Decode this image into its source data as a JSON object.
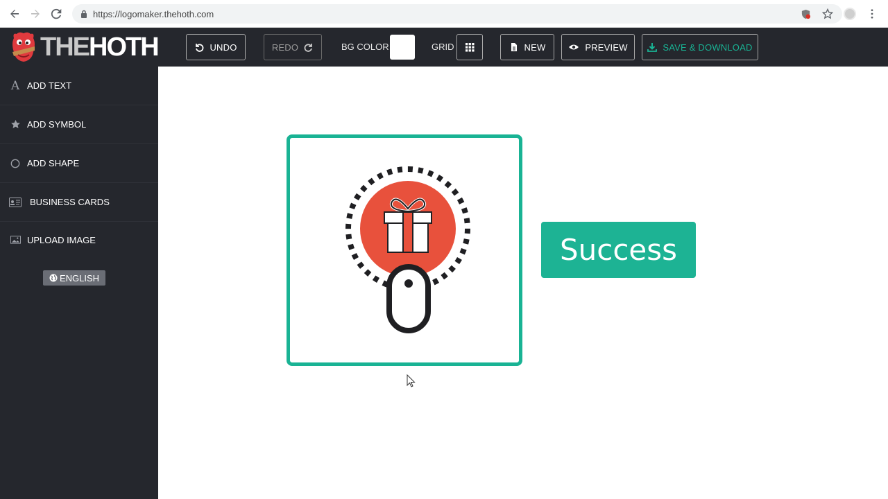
{
  "browser": {
    "url": "https://logomaker.thehoth.com"
  },
  "logo": {
    "text_the": "THE",
    "text_hoth": "HOTH"
  },
  "toolbar": {
    "undo_label": "UNDO",
    "redo_label": "REDO",
    "bg_color_label": "BG COLOR",
    "bg_color_value": "#ffffff",
    "grid_label": "GRID",
    "new_label": "NEW",
    "preview_label": "PREVIEW",
    "save_label": "SAVE & DOWNLOAD"
  },
  "sidebar": {
    "items": [
      {
        "label": "ADD TEXT",
        "icon": "letter-a-icon"
      },
      {
        "label": "ADD SYMBOL",
        "icon": "star-icon"
      },
      {
        "label": "ADD SHAPE",
        "icon": "circle-outline-icon"
      },
      {
        "label": "BUSINESS CARDS",
        "icon": "id-card-icon"
      },
      {
        "label": "UPLOAD IMAGE",
        "icon": "image-icon"
      }
    ],
    "language": "ENGLISH"
  },
  "canvas": {
    "success_text": "Success",
    "symbol": "gift-with-mouse-icon"
  },
  "colors": {
    "accent": "#19b394",
    "dark_bg": "#25272d",
    "symbol_red": "#e8513c"
  }
}
